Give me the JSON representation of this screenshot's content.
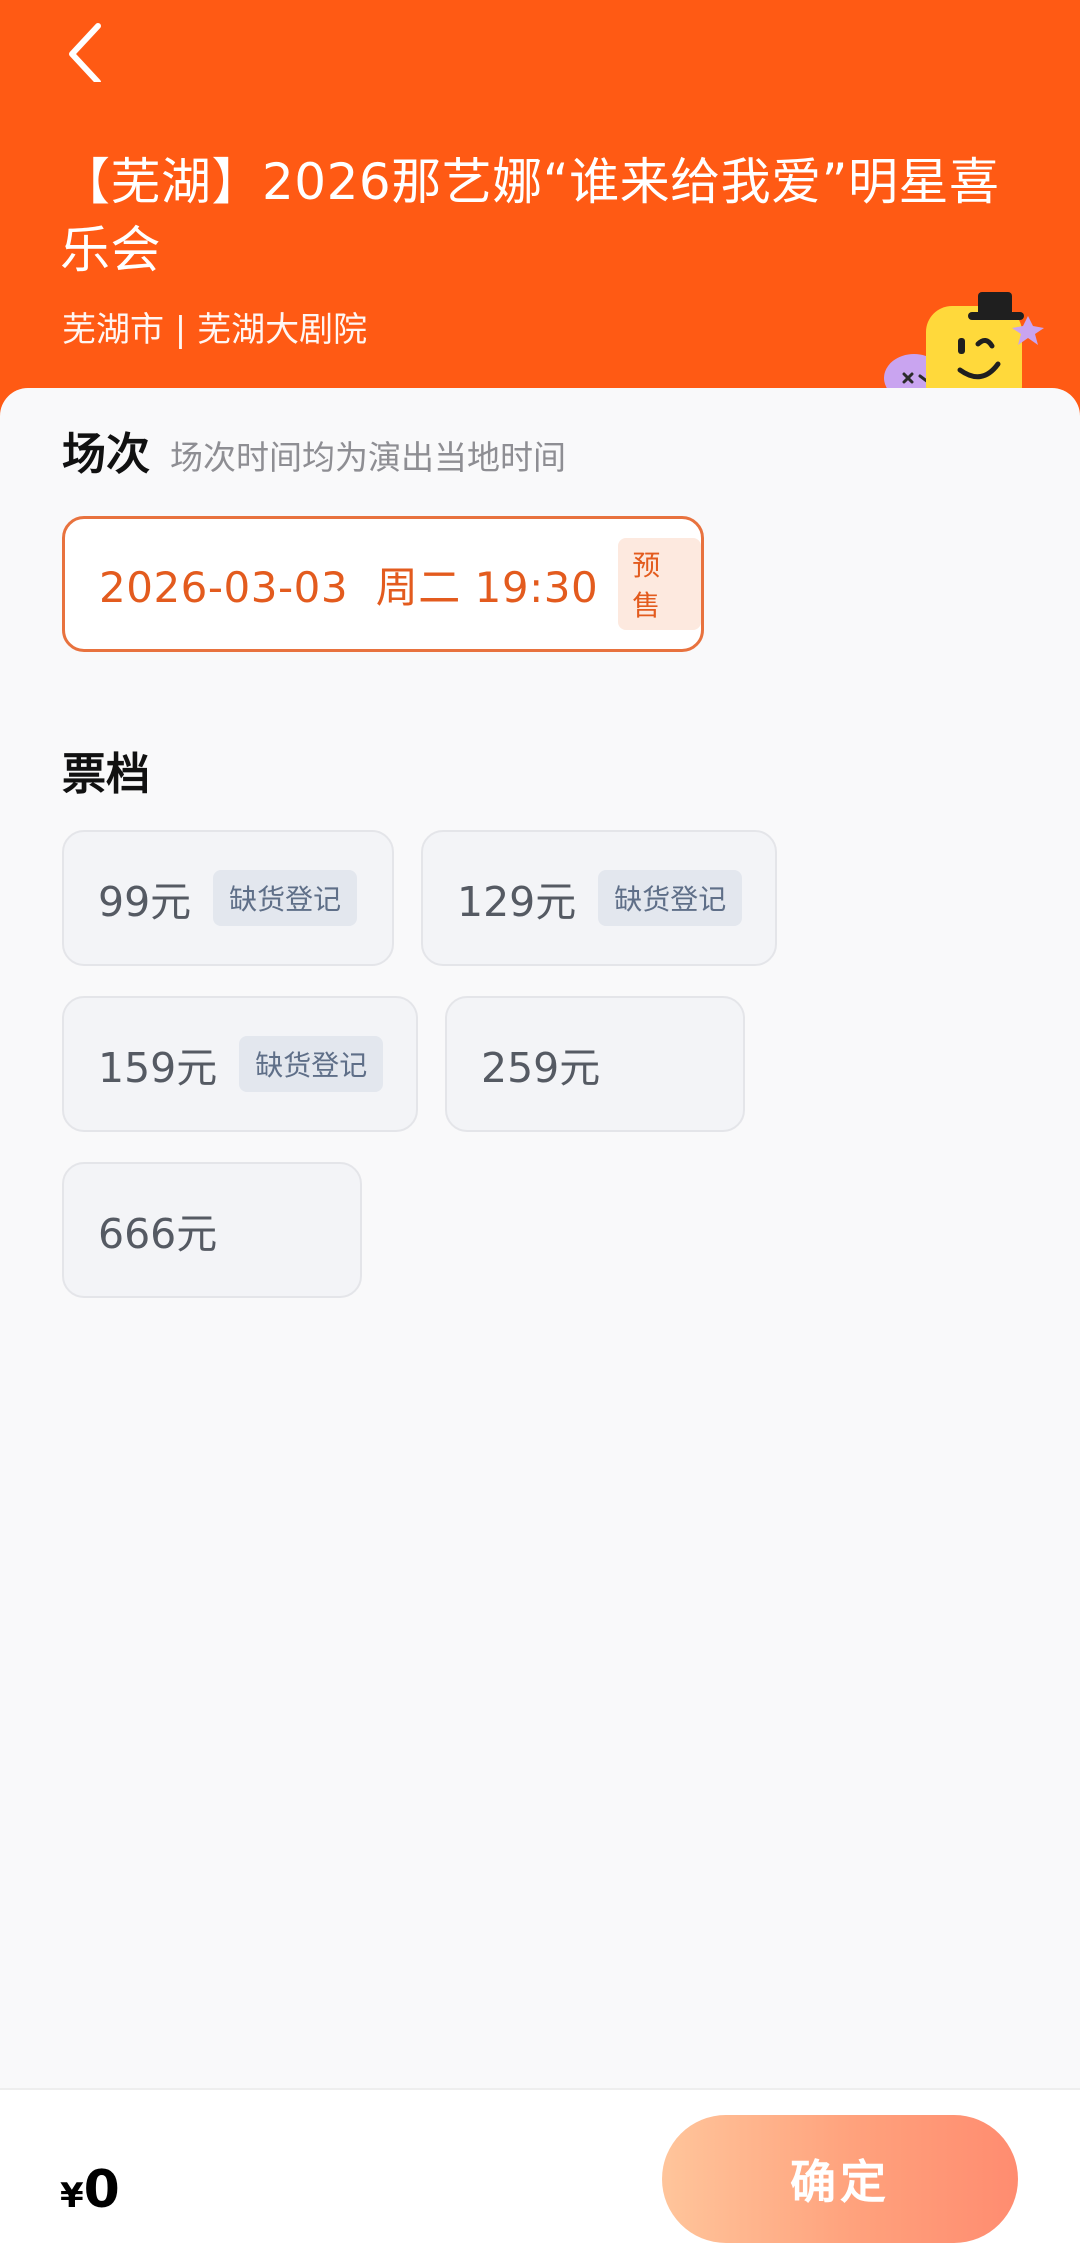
{
  "header": {
    "title": "【芜湖】2026那艺娜“谁来给我爱”明星喜乐会",
    "subtitle": "芜湖市 | 芜湖大剧院"
  },
  "session_section": {
    "title": "场次",
    "note": "场次时间均为演出当地时间",
    "selected_session": "2026-03-03  周二 19:30",
    "badge": "预售"
  },
  "ticket_section": {
    "title": "票档",
    "tiers": [
      {
        "price": "99元",
        "badge": "缺货登记"
      },
      {
        "price": "129元",
        "badge": "缺货登记"
      },
      {
        "price": "159元",
        "badge": "缺货登记"
      },
      {
        "price": "259元"
      },
      {
        "price": "666元"
      }
    ]
  },
  "bottom_bar": {
    "currency": "¥",
    "total": "0",
    "confirm_label": "确定"
  },
  "colors": {
    "header_bg": "#ff5a14",
    "accent": "#e35b1e",
    "confirm_gradient_start": "#ffc59b",
    "confirm_gradient_end": "#ff8c70"
  },
  "icons": {
    "back": "chevron-left-icon",
    "mascot": "mascot-illustration"
  }
}
